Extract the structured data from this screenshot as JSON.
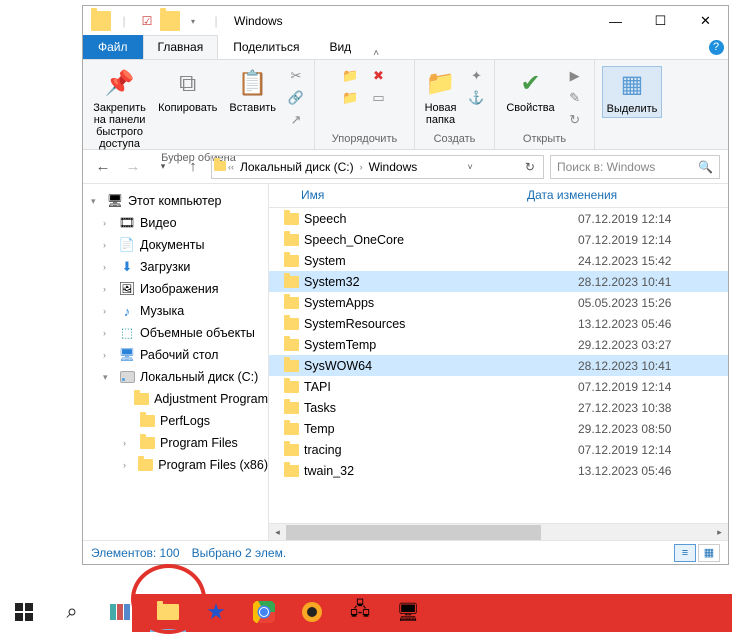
{
  "titlebar": {
    "title": "Windows"
  },
  "tabs": {
    "file": "Файл",
    "home": "Главная",
    "share": "Поделиться",
    "view": "Вид"
  },
  "ribbon": {
    "group1": {
      "pin": "Закрепить на панели\nбыстрого доступа",
      "copy": "Копировать",
      "paste": "Вставить",
      "label": "Буфер обмена"
    },
    "group2": {
      "label": "Упорядочить"
    },
    "group3": {
      "new_folder": "Новая\nпапка",
      "label": "Создать"
    },
    "group4": {
      "props": "Свойства",
      "label": "Открыть"
    },
    "group5": {
      "select": "Выделить"
    }
  },
  "address": {
    "crumb1": "Локальный диск (C:)",
    "crumb2": "Windows"
  },
  "search": {
    "placeholder": "Поиск в: Windows"
  },
  "tree": {
    "this_pc": "Этот компьютер",
    "videos": "Видео",
    "documents": "Документы",
    "downloads": "Загрузки",
    "pictures": "Изображения",
    "music": "Музыка",
    "objects3d": "Объемные объекты",
    "desktop": "Рабочий стол",
    "local_disk": "Локальный диск (C:)",
    "adj": "Adjustment Program",
    "perflogs": "PerfLogs",
    "progfiles": "Program Files",
    "progfiles86": "Program Files (x86)"
  },
  "columns": {
    "name": "Имя",
    "date": "Дата изменения"
  },
  "files": [
    {
      "name": "Speech",
      "date": "07.12.2019 12:14",
      "sel": false
    },
    {
      "name": "Speech_OneCore",
      "date": "07.12.2019 12:14",
      "sel": false
    },
    {
      "name": "System",
      "date": "24.12.2023 15:42",
      "sel": false
    },
    {
      "name": "System32",
      "date": "28.12.2023 10:41",
      "sel": true
    },
    {
      "name": "SystemApps",
      "date": "05.05.2023 15:26",
      "sel": false
    },
    {
      "name": "SystemResources",
      "date": "13.12.2023 05:46",
      "sel": false
    },
    {
      "name": "SystemTemp",
      "date": "29.12.2023 03:27",
      "sel": false
    },
    {
      "name": "SysWOW64",
      "date": "28.12.2023 10:41",
      "sel": true
    },
    {
      "name": "TAPI",
      "date": "07.12.2019 12:14",
      "sel": false
    },
    {
      "name": "Tasks",
      "date": "27.12.2023 10:38",
      "sel": false
    },
    {
      "name": "Temp",
      "date": "29.12.2023 08:50",
      "sel": false
    },
    {
      "name": "tracing",
      "date": "07.12.2019 12:14",
      "sel": false
    },
    {
      "name": "twain_32",
      "date": "13.12.2023 05:46",
      "sel": false
    }
  ],
  "status": {
    "items": "Элементов: 100",
    "selected": "Выбрано 2 элем."
  }
}
